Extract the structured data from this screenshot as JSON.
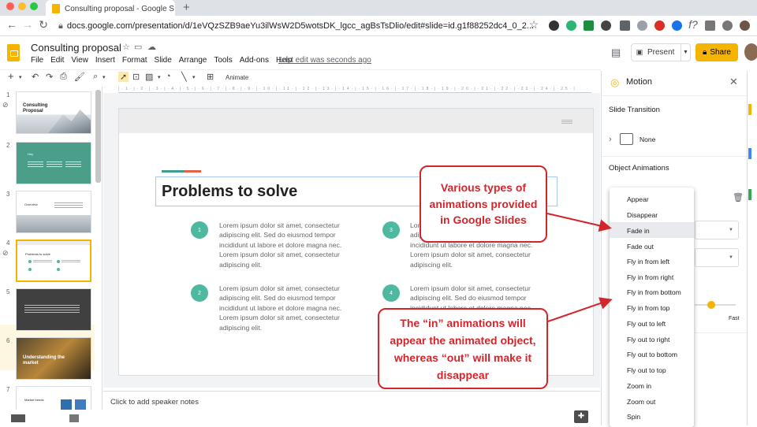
{
  "browser": {
    "tab_title": "Consulting proposal - Google S",
    "new_tab": "+",
    "url": "docs.google.com/presentation/d/1eVQzSZB9aeYu3ilWsW2D5wotsDK_lgcc_agBsTsDlio/edit#slide=id.g1f88252dc4_0_2..."
  },
  "header": {
    "title": "Consulting proposal",
    "menu": [
      "File",
      "Edit",
      "View",
      "Insert",
      "Format",
      "Slide",
      "Arrange",
      "Tools",
      "Add-ons",
      "Help"
    ],
    "last_edit": "Last edit was seconds ago",
    "present_label": "Present",
    "share_label": "Share"
  },
  "toolbar": {
    "animate_label": "Animate"
  },
  "filmstrip": {
    "slides": [
      {
        "num": "1",
        "title": "Consulting Proposal"
      },
      {
        "num": "2",
        "title": "Hey"
      },
      {
        "num": "3",
        "title": "Overview"
      },
      {
        "num": "4",
        "title": "Problems to solve"
      },
      {
        "num": "5",
        "title": ""
      },
      {
        "num": "6",
        "title": "Understanding the market"
      },
      {
        "num": "7",
        "title": "Market trends"
      }
    ]
  },
  "slide": {
    "title": "Problems to solve",
    "items": [
      {
        "num": "1",
        "text": "Lorem ipsum dolor sit amet, consectetur adipiscing elit. Sed do eiusmod tempor incididunt ut labore et dolore magna nec. Lorem ipsum dolor sit amet, consectetur adipiscing elit."
      },
      {
        "num": "3",
        "text": "Lorem ipsum dolor sit amet, consectetur adipiscing elit. Sed do eiusmod tempor incididunt ut labore et dolore magna nec. Lorem ipsum dolor sit amet, consectetur adipiscing elit."
      },
      {
        "num": "2",
        "text": "Lorem ipsum dolor sit amet, consectetur adipiscing elit. Sed do eiusmod tempor incididunt ut labore et dolore magna nec. Lorem ipsum dolor sit amet, consectetur adipiscing elit."
      },
      {
        "num": "4",
        "text": "Lorem ipsum dolor sit amet, consectetur adipiscing elit. Sed do eiusmod tempor incididunt ut labore et dolore magna nec. Lorem ipsum dolor sit amet, consectetur adipiscing elit."
      }
    ]
  },
  "notes": {
    "placeholder": "Click to add speaker notes"
  },
  "motion_panel": {
    "title": "Motion",
    "slide_transition_label": "Slide Transition",
    "transition_value": "None",
    "object_animations_label": "Object Animations",
    "speed_fast_label": "Fast"
  },
  "animation_dropdown": {
    "highlighted": "Fade in",
    "options": [
      "Appear",
      "Disappear",
      "Fade in",
      "Fade out",
      "Fly in from left",
      "Fly in from right",
      "Fly in from bottom",
      "Fly in from top",
      "Fly out to left",
      "Fly out to right",
      "Fly out to bottom",
      "Fly out to top",
      "Zoom in",
      "Zoom out",
      "Spin"
    ]
  },
  "callouts": {
    "c1": "Various types of animations provided in Google Slides",
    "c2": "The “in” animations will appear the animated object, whereas “out” will make it disappear"
  },
  "colors": {
    "accent": "#f4b400",
    "callout_red": "#d4252c",
    "teal": "#4fb99f"
  }
}
